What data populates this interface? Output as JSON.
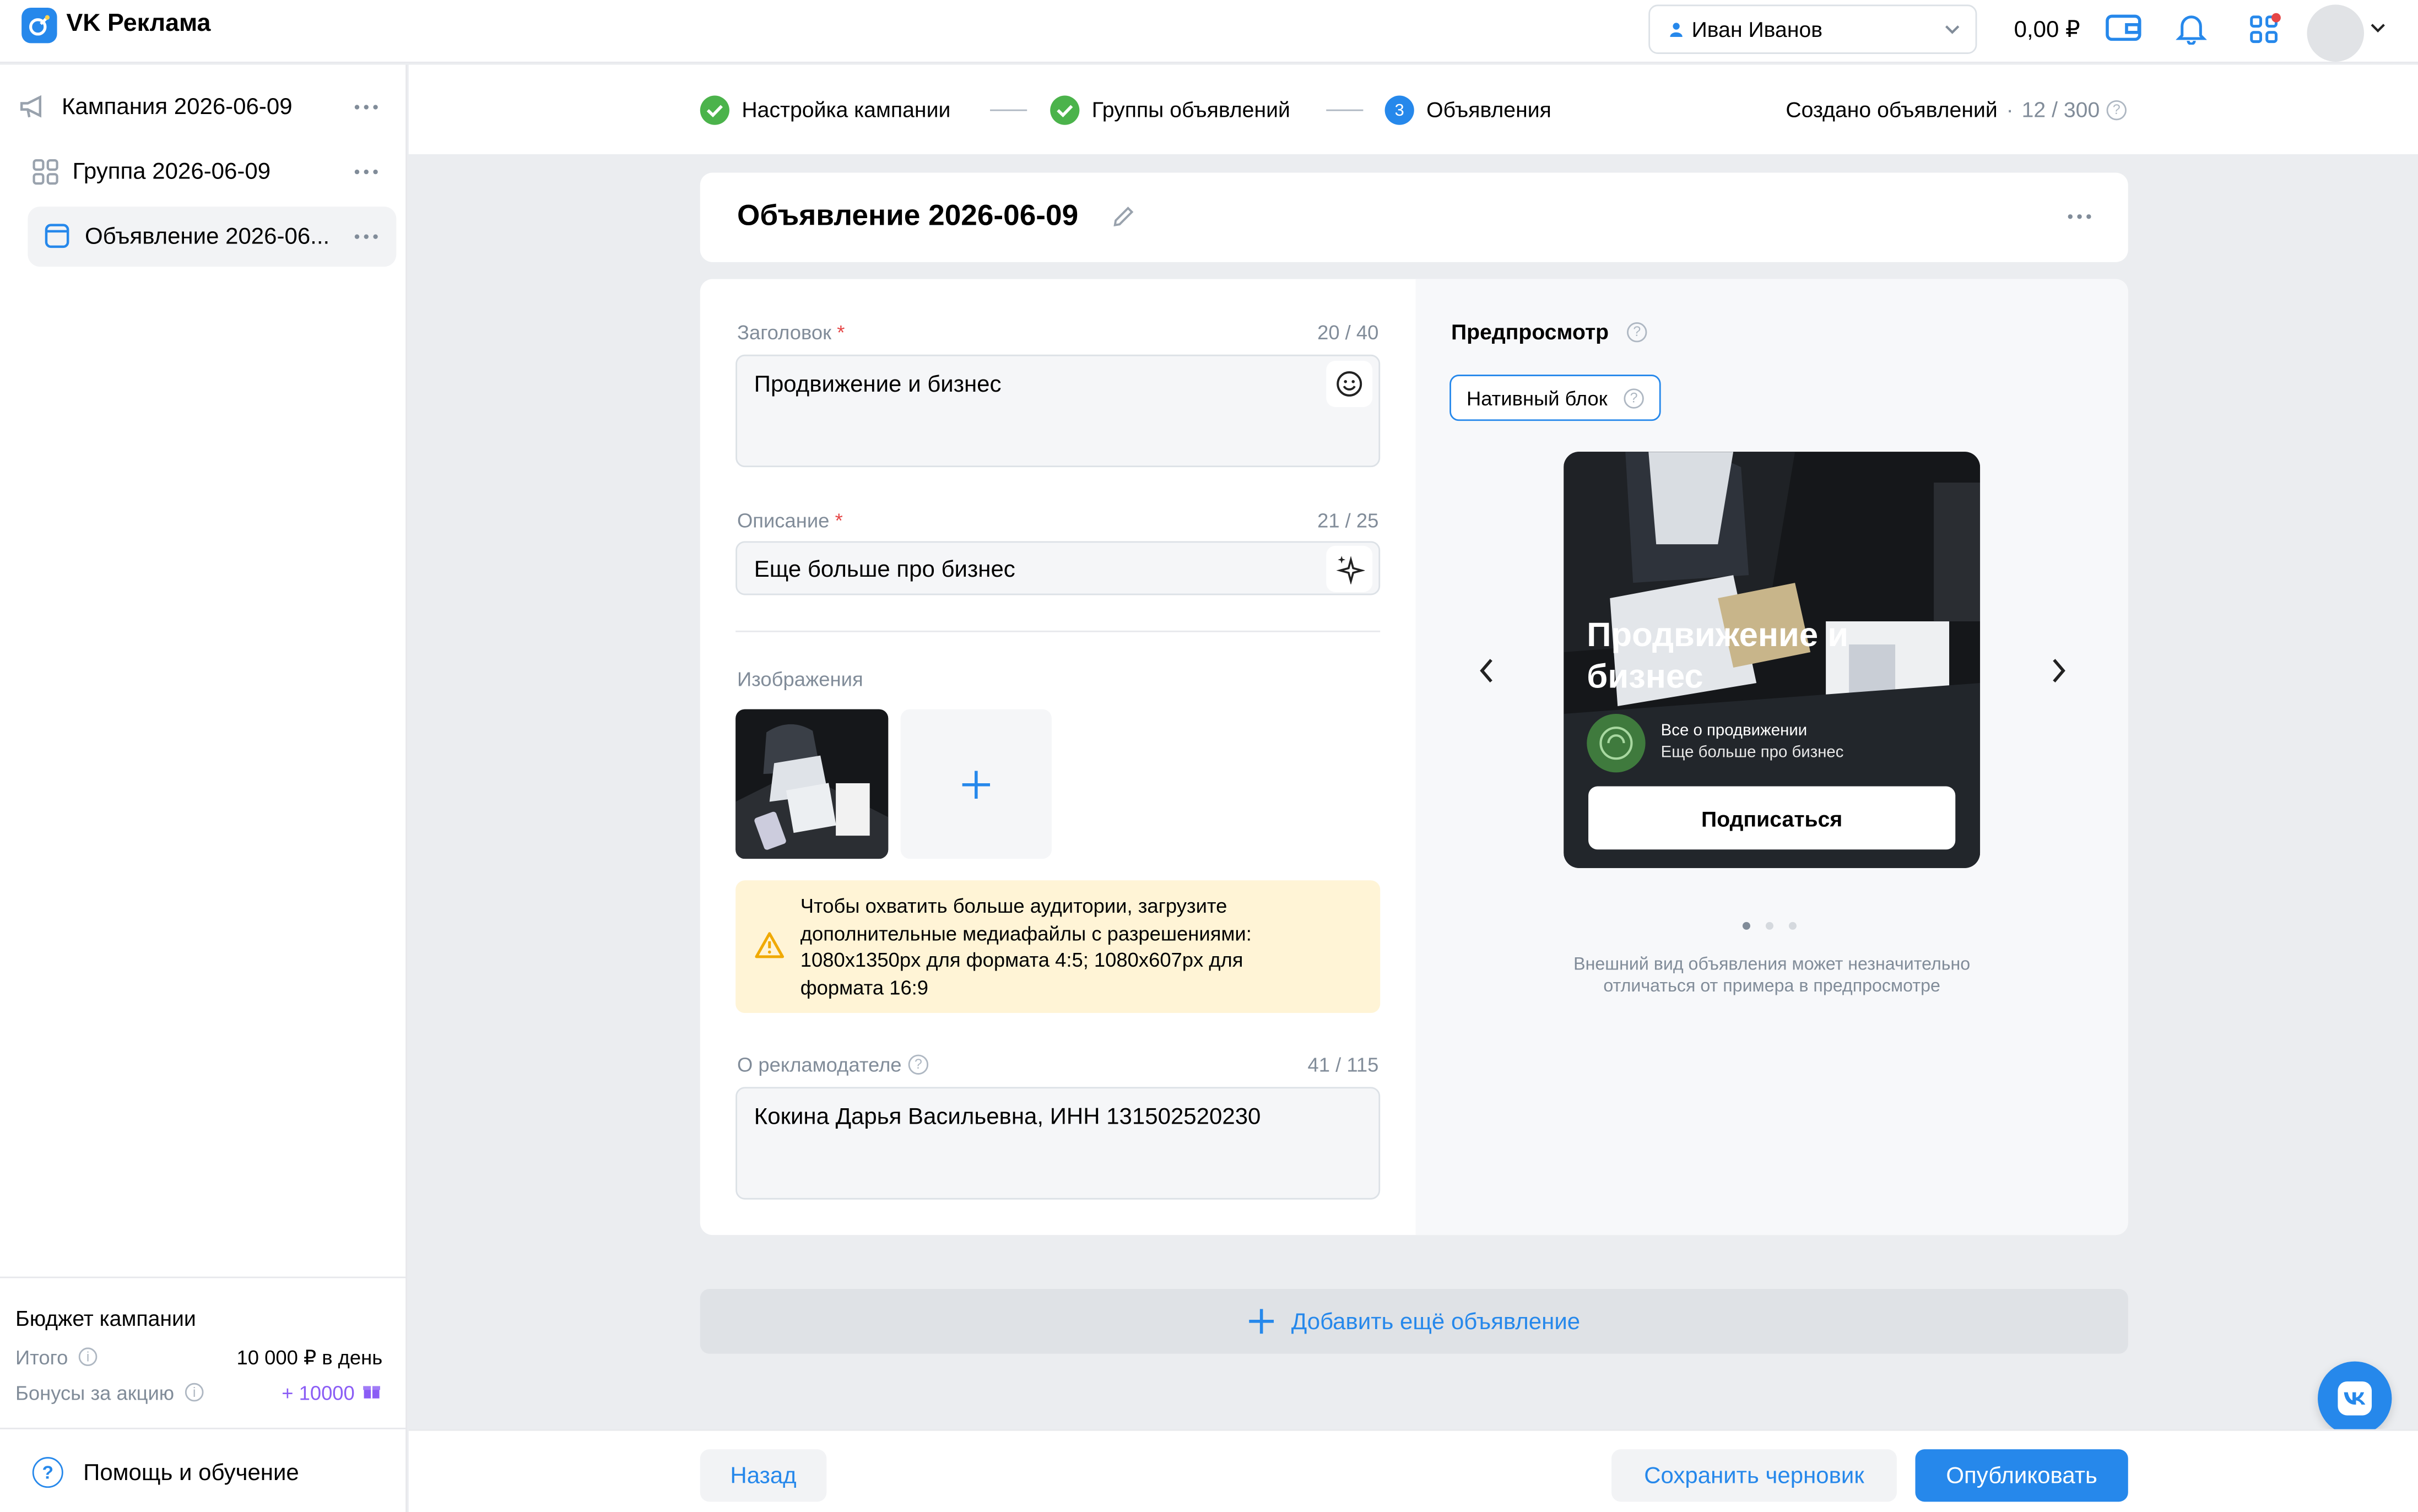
{
  "app": {
    "logo_text": "VK Реклама"
  },
  "header": {
    "user_name": "Иван Иванов",
    "balance": "0,00 ₽"
  },
  "sidebar": {
    "items": [
      {
        "label": "Кампания 2026-06-09"
      },
      {
        "label": "Группа 2026-06-09"
      },
      {
        "label": "Объявление 2026-06..."
      }
    ],
    "budget": {
      "title": "Бюджет кампании",
      "total_label": "Итого",
      "total_value": "10 000 ₽ в день",
      "bonus_label": "Бонусы за акцию",
      "bonus_value": "+ 10000"
    },
    "help_label": "Помощь и обучение"
  },
  "steps": {
    "items": [
      {
        "label": "Настройка кампании",
        "state": "done"
      },
      {
        "label": "Группы объявлений",
        "state": "done"
      },
      {
        "label": "Объявления",
        "state": "active",
        "number": "3"
      }
    ],
    "created_label": "Создано объявлений",
    "created_value": "12 / 300"
  },
  "ad": {
    "title": "Объявление 2026-06-09",
    "headline": {
      "label": "Заголовок",
      "counter": "20 / 40",
      "value": "Продвижение и бизнес"
    },
    "description": {
      "label": "Описание",
      "counter": "21 / 25",
      "value": "Еще больше про бизнес"
    },
    "images_label": "Изображения",
    "warning": "Чтобы охватить больше аудитории, загрузите дополнительные медиафайлы с разрешениями: 1080x1350px для формата 4:5; 1080x607px для формата 16:9",
    "advertiser": {
      "label": "О рекламодателе",
      "counter": "41 / 115",
      "value": "Кокина Дарья Васильевна, ИНН 131502520230"
    }
  },
  "preview": {
    "title": "Предпросмотр",
    "format_chip": "Нативный блок",
    "card_title": "Продвижение и бизнес",
    "card_sub1": "Все о продвижении",
    "card_sub2": "Еще больше про бизнес",
    "card_button": "Подписаться",
    "note": "Внешний вид объявления может незначительно отличаться от примера в предпросмотре",
    "page_count": 3,
    "active_page": 1
  },
  "add_more_label": "Добавить ещё объявление",
  "footer": {
    "back": "Назад",
    "save_draft": "Сохранить черновик",
    "publish": "Опубликовать"
  },
  "colors": {
    "accent": "#2688eb",
    "success": "#4bb34b",
    "warning_bg": "#fff4d6",
    "bonus": "#8a5cf5"
  }
}
